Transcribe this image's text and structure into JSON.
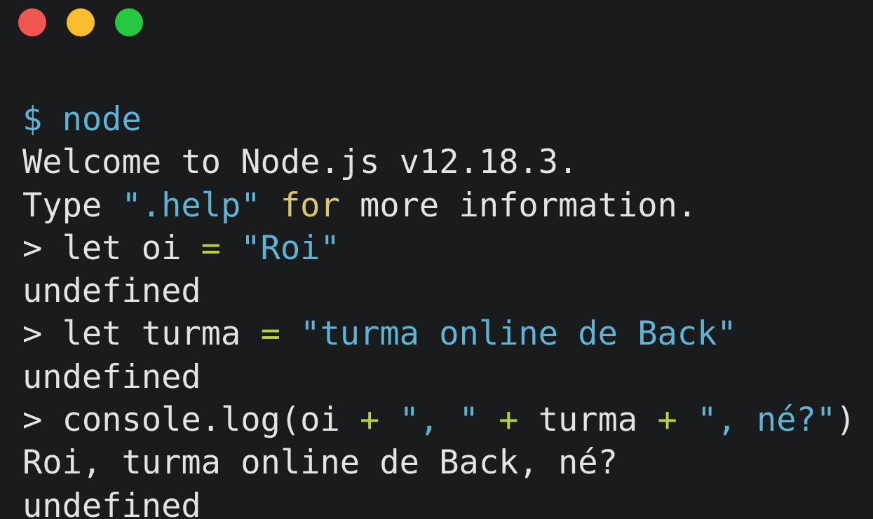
{
  "window": {
    "controls": [
      {
        "name": "close",
        "color": "#f25650"
      },
      {
        "name": "minimize",
        "color": "#fbbc2e"
      },
      {
        "name": "maximize",
        "color": "#27c83f"
      }
    ]
  },
  "colors": {
    "background": "#1a1b1c",
    "text": "#e3e3e3",
    "string": "#5fb3d4",
    "keyword": "#dec76a",
    "operator": "#b4d244"
  },
  "terminal": {
    "lines": [
      {
        "name": "prompt-node",
        "tokens": [
          {
            "t": "$ node",
            "c": "blue"
          }
        ]
      },
      {
        "name": "welcome-line",
        "tokens": [
          {
            "t": "Welcome to Node.js v12.18.3.",
            "c": "text"
          }
        ]
      },
      {
        "name": "help-line",
        "tokens": [
          {
            "t": "Type ",
            "c": "text"
          },
          {
            "t": "\".help\"",
            "c": "blue"
          },
          {
            "t": " ",
            "c": "text"
          },
          {
            "t": "for",
            "c": "yellow"
          },
          {
            "t": " more information.",
            "c": "text"
          }
        ]
      },
      {
        "name": "input-let-oi",
        "tokens": [
          {
            "t": "> let oi ",
            "c": "text"
          },
          {
            "t": "=",
            "c": "green"
          },
          {
            "t": " ",
            "c": "text"
          },
          {
            "t": "\"Roi\"",
            "c": "blue"
          }
        ]
      },
      {
        "name": "output-undefined-1",
        "tokens": [
          {
            "t": "undefined",
            "c": "text"
          }
        ]
      },
      {
        "name": "input-let-turma",
        "tokens": [
          {
            "t": "> let turma ",
            "c": "text"
          },
          {
            "t": "=",
            "c": "green"
          },
          {
            "t": " ",
            "c": "text"
          },
          {
            "t": "\"turma online de Back\"",
            "c": "blue"
          }
        ]
      },
      {
        "name": "output-undefined-2",
        "tokens": [
          {
            "t": "undefined",
            "c": "text"
          }
        ]
      },
      {
        "name": "input-console-log",
        "tokens": [
          {
            "t": "> console.log(oi ",
            "c": "text"
          },
          {
            "t": "+",
            "c": "green"
          },
          {
            "t": " ",
            "c": "text"
          },
          {
            "t": "\", \"",
            "c": "blue"
          },
          {
            "t": " ",
            "c": "text"
          },
          {
            "t": "+",
            "c": "green"
          },
          {
            "t": " turma ",
            "c": "text"
          },
          {
            "t": "+",
            "c": "green"
          },
          {
            "t": " ",
            "c": "text"
          },
          {
            "t": "\", né?\"",
            "c": "blue"
          },
          {
            "t": ")",
            "c": "text"
          }
        ]
      },
      {
        "name": "output-log-result",
        "tokens": [
          {
            "t": "Roi, turma online de Back, né?",
            "c": "text"
          }
        ]
      },
      {
        "name": "output-undefined-3",
        "tokens": [
          {
            "t": "undefined",
            "c": "text"
          }
        ]
      }
    ]
  }
}
